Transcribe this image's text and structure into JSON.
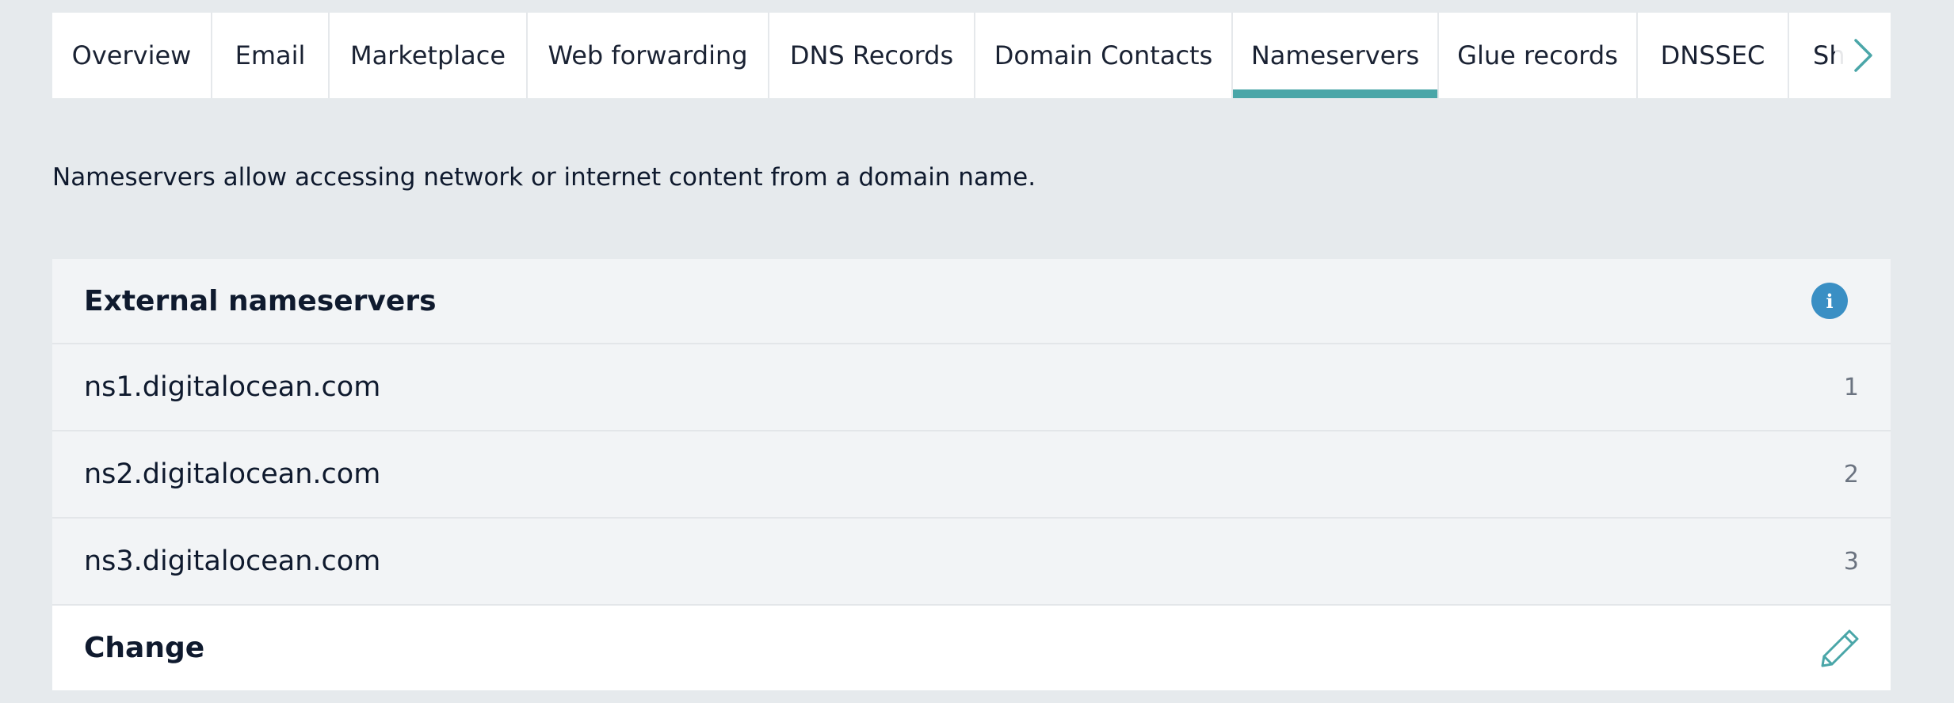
{
  "tabs": [
    {
      "label": "Overview",
      "active": false
    },
    {
      "label": "Email",
      "active": false
    },
    {
      "label": "Marketplace",
      "active": false
    },
    {
      "label": "Web forwarding",
      "active": false
    },
    {
      "label": "DNS Records",
      "active": false
    },
    {
      "label": "Domain Contacts",
      "active": false
    },
    {
      "label": "Nameservers",
      "active": true
    },
    {
      "label": "Glue records",
      "active": false
    },
    {
      "label": "DNSSEC",
      "active": false
    },
    {
      "label": "Sh",
      "active": false
    }
  ],
  "tab_scroll_icon": "chevron-right-icon",
  "intro_text": "Nameservers allow accessing network or internet content from a domain name.",
  "panel": {
    "title": "External nameservers",
    "info_icon": "info-icon",
    "info_glyph": "i",
    "nameservers": [
      {
        "name": "ns1.digitalocean.com",
        "index": "1"
      },
      {
        "name": "ns2.digitalocean.com",
        "index": "2"
      },
      {
        "name": "ns3.digitalocean.com",
        "index": "3"
      }
    ],
    "change_label": "Change",
    "change_icon": "pencil-icon"
  },
  "colors": {
    "page_background": "#e6eaed",
    "active_tab_underline": "#4aa6a8",
    "info_icon": "#3a8fc4",
    "pencil_icon": "#4aa6a8",
    "chevron": "#4aa6a8"
  }
}
